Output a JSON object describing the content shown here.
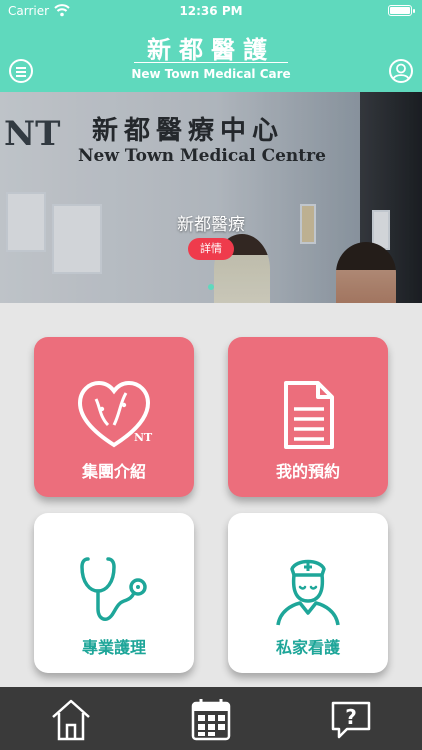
{
  "status_bar": {
    "carrier": "Carrier",
    "time": "12:36 PM"
  },
  "header": {
    "title_cn": "新都醫護",
    "title_en": "New Town Medical Care",
    "menu_icon": "hamburger-circle-icon",
    "profile_icon": "user-circle-icon"
  },
  "banner": {
    "title": "新都醫療",
    "detail_label": "詳情",
    "photo_sign_cn": "新都醫療中心",
    "photo_sign_en": "New Town Medical Centre",
    "photo_logo": "NT",
    "active_dot_color": "#5fd9bd"
  },
  "grid": {
    "cards": [
      {
        "label": "集團介紹",
        "icon": "heart-faces-logo-icon",
        "style": "pink"
      },
      {
        "label": "我的預約",
        "icon": "document-icon",
        "style": "pink"
      },
      {
        "label": "專業護理",
        "icon": "stethoscope-icon",
        "style": "white"
      },
      {
        "label": "私家看護",
        "icon": "nurse-icon",
        "style": "white"
      }
    ]
  },
  "tabbar": {
    "items": [
      {
        "icon": "home-icon"
      },
      {
        "icon": "calendar-icon"
      },
      {
        "icon": "help-bubble-icon"
      }
    ]
  },
  "colors": {
    "header": "#5fd9bd",
    "pink_card": "#ec6e7c",
    "white_card_text": "#1ea699",
    "tabbar": "#3a3a3a",
    "detail_button": "#ef3b4c"
  }
}
